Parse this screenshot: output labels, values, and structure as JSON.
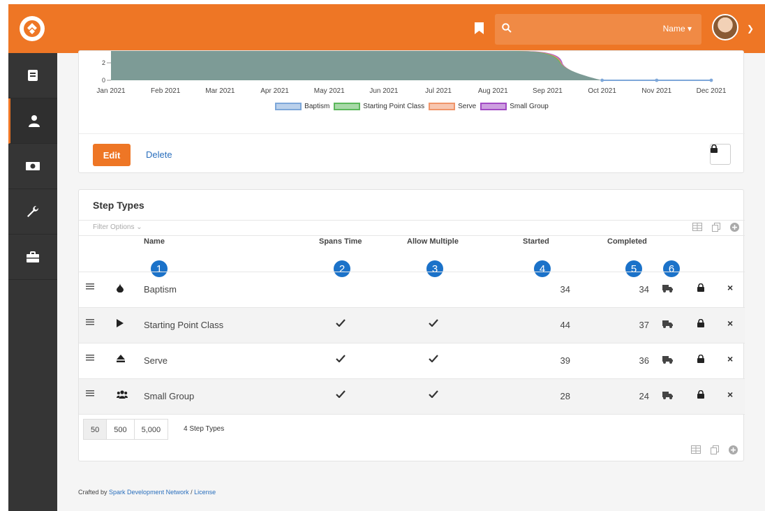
{
  "header": {
    "search_scope": "Name ▾"
  },
  "sidebar": {
    "items": [
      {
        "icon": "book-icon"
      },
      {
        "icon": "person-icon",
        "active": true
      },
      {
        "icon": "money-icon"
      },
      {
        "icon": "wrench-icon"
      },
      {
        "icon": "briefcase-icon"
      }
    ]
  },
  "chart_data": {
    "type": "area",
    "x": [
      "Jan 2021",
      "Feb 2021",
      "Mar 2021",
      "Apr 2021",
      "May 2021",
      "Jun 2021",
      "Jul 2021",
      "Aug 2021",
      "Sep 2021",
      "Oct 2021",
      "Nov 2021",
      "Dec 2021"
    ],
    "y_ticks_visible": [
      "2",
      "0"
    ],
    "series": [
      {
        "name": "Baptism",
        "color": "#7da7d9"
      },
      {
        "name": "Starting Point Class",
        "color": "#5cb85c"
      },
      {
        "name": "Serve",
        "color": "#f0956a"
      },
      {
        "name": "Small Group",
        "color": "#a24bc4"
      }
    ]
  },
  "actions": {
    "edit": "Edit",
    "delete": "Delete"
  },
  "step_types": {
    "title": "Step Types",
    "filter_label": "Filter Options",
    "columns": {
      "name": "Name",
      "spans_time": "Spans Time",
      "allow_multiple": "Allow Multiple",
      "started": "Started",
      "completed": "Completed"
    },
    "badges": [
      "1",
      "2",
      "3",
      "4",
      "5",
      "6"
    ],
    "rows": [
      {
        "icon": "water-drop-icon",
        "name": "Baptism",
        "spans_time": false,
        "allow_multiple": false,
        "started": "34",
        "completed": "34"
      },
      {
        "icon": "play-icon",
        "name": "Starting Point Class",
        "spans_time": true,
        "allow_multiple": true,
        "started": "44",
        "completed": "37"
      },
      {
        "icon": "eject-icon",
        "name": "Serve",
        "spans_time": true,
        "allow_multiple": true,
        "started": "39",
        "completed": "36"
      },
      {
        "icon": "users-icon",
        "name": "Small Group",
        "spans_time": true,
        "allow_multiple": true,
        "started": "28",
        "completed": "24"
      }
    ],
    "page_sizes": [
      "50",
      "500",
      "5,000"
    ],
    "count_label": "4 Step Types"
  },
  "footer": {
    "prefix": "Crafted by ",
    "org": "Spark Development Network",
    "sep": " / ",
    "license": "License"
  }
}
